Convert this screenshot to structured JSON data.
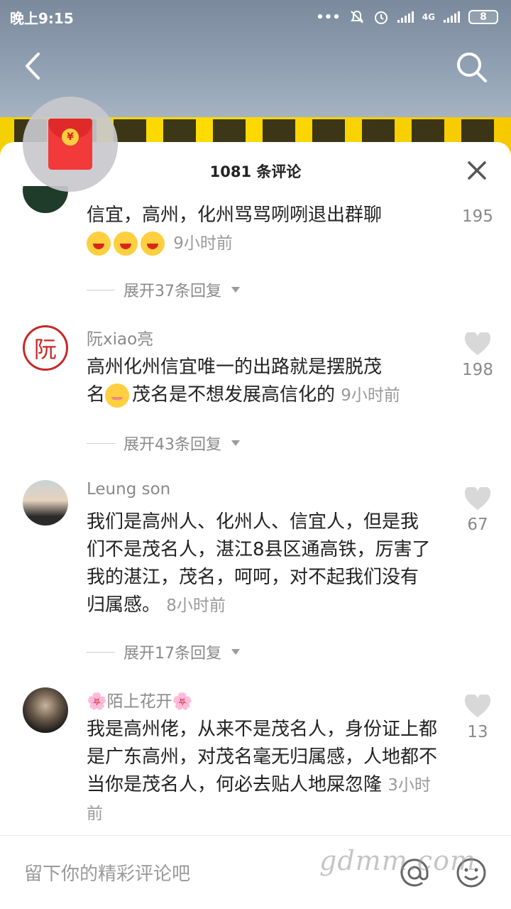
{
  "status_bar": {
    "time": "晚上9:15",
    "dots": "•••",
    "network": "4G",
    "battery": "8"
  },
  "header": {
    "comment_count": "1081 条评论"
  },
  "comments": [
    {
      "text": "信宜，高州，化州骂骂咧咧退出群聊",
      "time": "9小时前",
      "likes": "195",
      "replies": "展开37条回复"
    },
    {
      "user": "阮xiao亮",
      "avatar_char": "阮",
      "text_a": "高州化州信宜唯一的出路就是摆脱茂",
      "text_b_prefix": "名",
      "text_b": "茂名是不想发展高信化的",
      "time": "9小时前",
      "likes": "198",
      "replies": "展开43条回复"
    },
    {
      "user": "Leung son",
      "text": "我们是高州人、化州人、信宜人，但是我们不是茂名人，湛江8县区通高铁，厉害了我的湛江，茂名，呵呵，对不起我们没有归属感。",
      "time": "8小时前",
      "likes": "67",
      "replies": "展开17条回复"
    },
    {
      "user": "🌸陌上花开🌸",
      "text": "我是高州佬，从来不是茂名人，身份证上都是广东高州，对茂名毫无归属感，人地都不当你是茂名人，何必去贴人地屎忽隆",
      "time": "3小时前",
      "likes": "13"
    }
  ],
  "input": {
    "placeholder": "留下你的精彩评论吧"
  },
  "watermark": "gdmm.com",
  "colors": {
    "accent_red": "#f23a3a",
    "text_gray": "#8a8a8a"
  }
}
